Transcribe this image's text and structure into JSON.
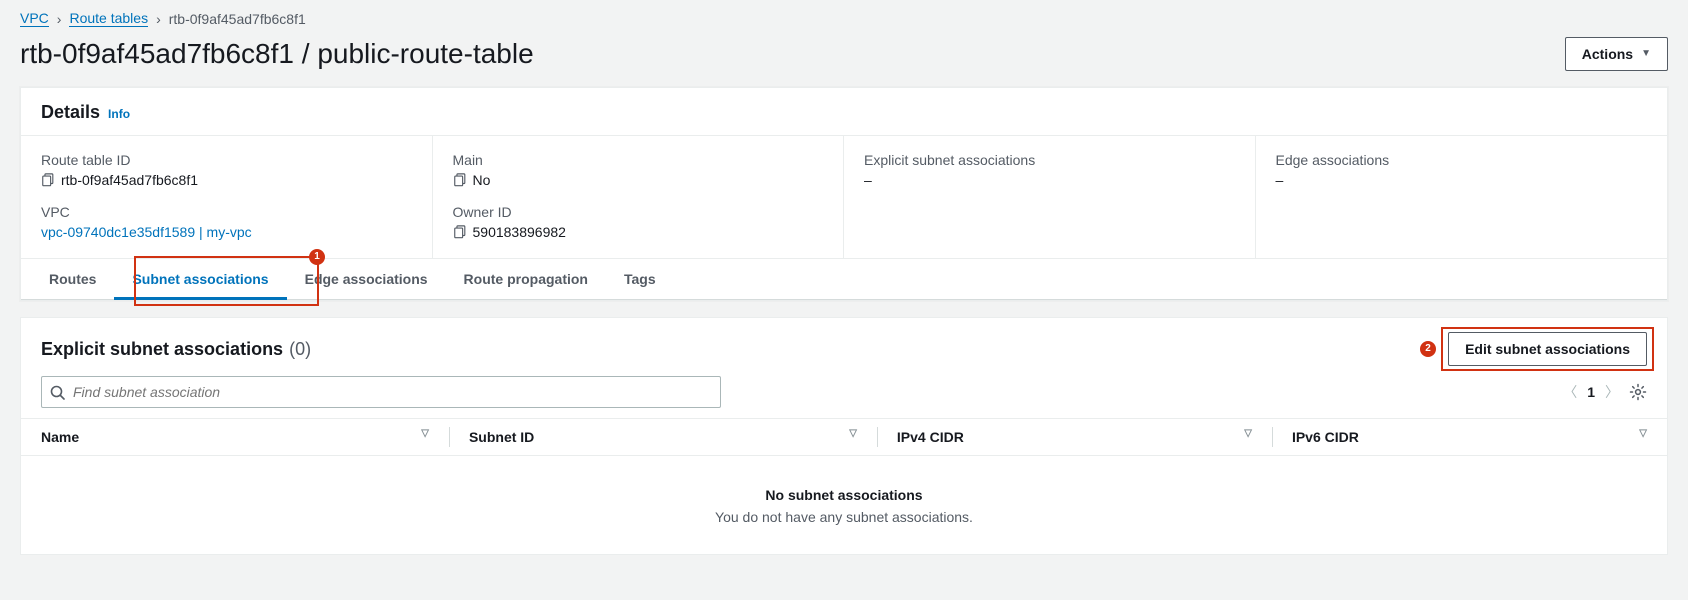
{
  "breadcrumbs": {
    "items": [
      "VPC",
      "Route tables",
      "rtb-0f9af45ad7fb6c8f1"
    ]
  },
  "header": {
    "title": "rtb-0f9af45ad7fb6c8f1 / public-route-table",
    "actions_label": "Actions"
  },
  "details": {
    "title": "Details",
    "info_label": "Info",
    "route_table_id": {
      "label": "Route table ID",
      "value": "rtb-0f9af45ad7fb6c8f1"
    },
    "vpc": {
      "label": "VPC",
      "value": "vpc-09740dc1e35df1589 | my-vpc"
    },
    "main": {
      "label": "Main",
      "value": "No"
    },
    "owner_id": {
      "label": "Owner ID",
      "value": "590183896982"
    },
    "explicit_assoc": {
      "label": "Explicit subnet associations",
      "value": "–"
    },
    "edge_assoc": {
      "label": "Edge associations",
      "value": "–"
    }
  },
  "tabs": {
    "items": [
      "Routes",
      "Subnet associations",
      "Edge associations",
      "Route propagation",
      "Tags"
    ],
    "active_index": 1
  },
  "annotations": {
    "badge1": "1",
    "badge2": "2"
  },
  "assoc": {
    "title": "Explicit subnet associations",
    "count": "(0)",
    "edit_label": "Edit subnet associations",
    "search_placeholder": "Find subnet association",
    "page_current": "1",
    "columns": [
      "Name",
      "Subnet ID",
      "IPv4 CIDR",
      "IPv6 CIDR"
    ],
    "empty_title": "No subnet associations",
    "empty_sub": "You do not have any subnet associations."
  }
}
